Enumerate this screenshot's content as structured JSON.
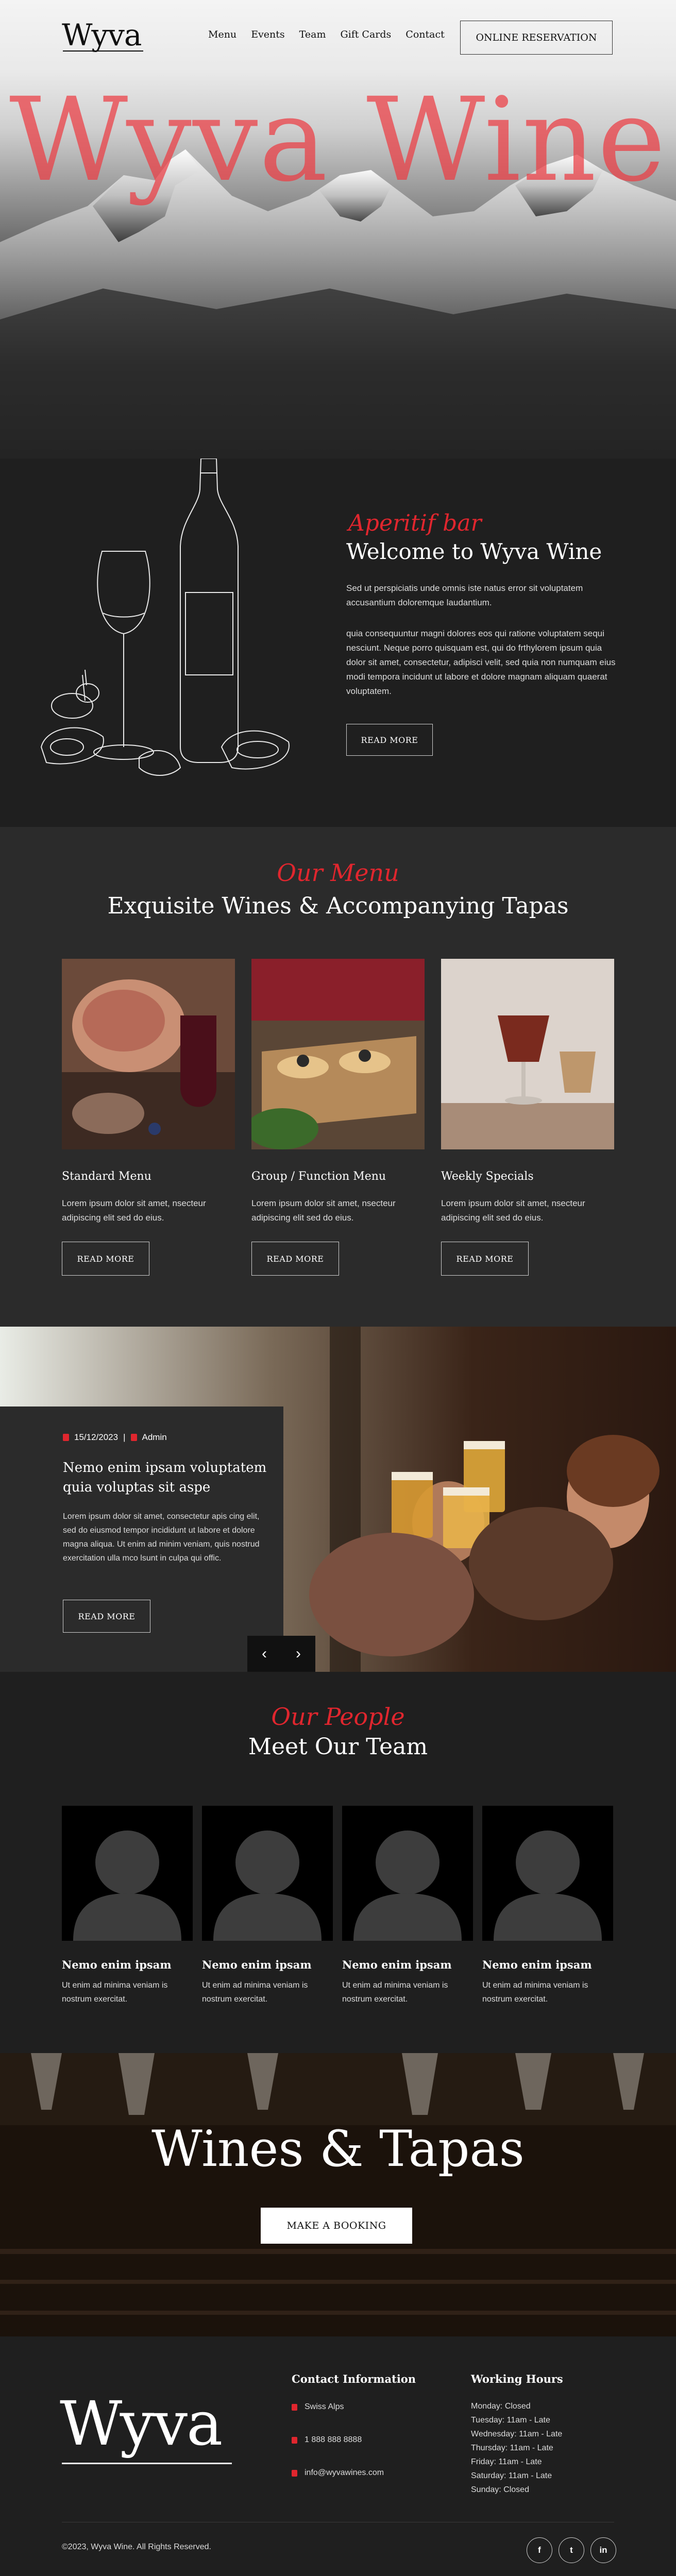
{
  "brand": {
    "name": "Wyva"
  },
  "nav": {
    "links": [
      "Menu",
      "Events",
      "Team",
      "Gift Cards",
      "Contact"
    ],
    "reservation_label": "ONLINE RESERVATION"
  },
  "hero": {
    "title": "Wyva Wine"
  },
  "welcome": {
    "script": "Aperitif bar",
    "title": "Welcome to Wyva Wine",
    "p1": "Sed ut perspiciatis unde omnis iste natus error sit voluptatem accusantium doloremque laudantium.",
    "p2": "quia consequuntur magni dolores eos qui ratione voluptatem sequi nesciunt. Neque porro quisquam est, qui do frthylorem ipsum quia dolor sit amet, consectetur, adipisci velit, sed quia non numquam eius modi tempora incidunt ut labore et dolore magnam aliquam quaerat voluptatem.",
    "button": "READ MORE"
  },
  "menu": {
    "script": "Our Menu",
    "title": "Exquisite Wines & Accompanying Tapas",
    "cards": [
      {
        "title": "Standard Menu",
        "text": "Lorem ipsum dolor sit amet, nsecteur adipiscing elit sed do eius.",
        "button": "READ MORE"
      },
      {
        "title": "Group / Function Menu",
        "text": "Lorem ipsum dolor sit amet, nsecteur adipiscing elit sed do eius.",
        "button": "READ MORE"
      },
      {
        "title": "Weekly Specials",
        "text": "Lorem ipsum dolor sit amet, nsecteur adipiscing elit sed do eius.",
        "button": "READ MORE"
      }
    ]
  },
  "blog": {
    "date": "15/12/2023",
    "separator": "|",
    "author": "Admin",
    "title": "Nemo enim ipsam voluptatem quia voluptas sit aspe",
    "text": "Lorem ipsum dolor sit amet, consectetur apis cing elit, sed do eiusmod tempor incididunt ut labore et dolore magna aliqua. Ut enim ad minim veniam, quis nostrud exercitation ulla mco lsunt in culpa qui offic.",
    "button": "READ MORE",
    "prev": "‹",
    "next": "›"
  },
  "team": {
    "script": "Our People",
    "title": "Meet Our Team",
    "members": [
      {
        "name": "Nemo enim ipsam",
        "text": "Ut enim ad minima veniam is nostrum exercitat."
      },
      {
        "name": "Nemo enim ipsam",
        "text": "Ut enim ad minima veniam is nostrum exercitat."
      },
      {
        "name": "Nemo enim ipsam",
        "text": "Ut enim ad minima veniam is nostrum exercitat."
      },
      {
        "name": "Nemo enim ipsam",
        "text": "Ut enim ad minima veniam is nostrum exercitat."
      }
    ]
  },
  "cta": {
    "title": "Wines & Tapas",
    "button": "MAKE A BOOKING"
  },
  "footer": {
    "contact_heading": "Contact Information",
    "location": "Swiss Alps",
    "phone": "1 888 888 8888",
    "email": "info@wyvawines.com",
    "hours_heading": "Working Hours",
    "hours": [
      "Monday: Closed",
      "Tuesday: 11am - Late",
      "Wednesday: 11am - Late",
      "Thursday: 11am - Late",
      "Friday: 11am - Late",
      "Saturday: 11am - Late",
      "Sunday: Closed"
    ],
    "copyright": "©2023, Wyva Wine. All Rights Reserved.",
    "socials": [
      "f",
      "t",
      "in"
    ]
  },
  "colors": {
    "accent": "#e0262e",
    "dark": "#1f1f1f",
    "panel": "#2b2b2b"
  },
  "icons": [
    "location-pin-icon",
    "phone-icon",
    "mail-icon",
    "calendar-icon",
    "user-icon",
    "facebook-icon",
    "twitter-icon",
    "linkedin-icon"
  ]
}
